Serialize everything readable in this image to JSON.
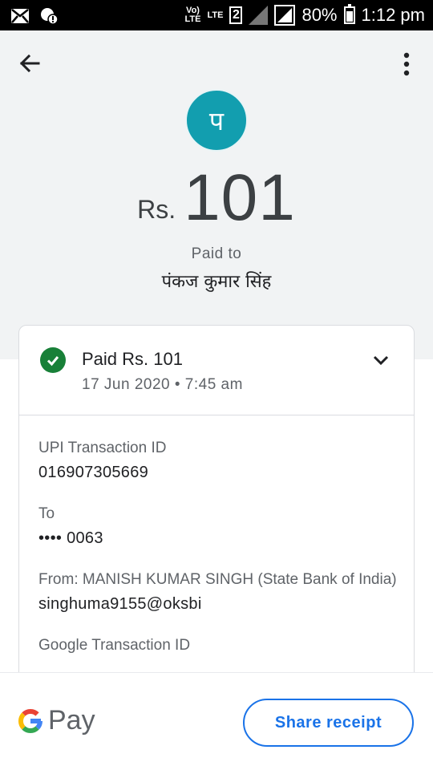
{
  "status_bar": {
    "volte_line1": "Vo)",
    "volte_line2": "LTE",
    "lte": "LTE",
    "sim_number": "2",
    "battery": "80%",
    "time": "1:12 pm"
  },
  "header": {
    "back_icon": "arrow-left-icon",
    "menu_icon": "more-vertical-icon"
  },
  "payee": {
    "avatar_letter": "प",
    "avatar_color": "#129eaf",
    "currency": "Rs.",
    "amount": "101",
    "paid_to_label": "Paid to",
    "name": "पंकज कुमार सिंह"
  },
  "transaction": {
    "status_icon": "check-circle-icon",
    "status_color": "#188038",
    "title": "Paid Rs. 101",
    "date": "17 Jun 2020 • 7:45 am",
    "details": [
      {
        "label": "UPI Transaction ID",
        "value": "016907305669"
      },
      {
        "label": "To",
        "value": "•••• 0063"
      },
      {
        "label": "From: MANISH KUMAR  SINGH (State Bank of India)",
        "value": "singhuma9155@oksbi"
      },
      {
        "label": "Google Transaction ID",
        "value": ""
      }
    ]
  },
  "footer": {
    "brand_text": "Pay",
    "share_label": "Share receipt",
    "accent": "#1a73e8"
  }
}
